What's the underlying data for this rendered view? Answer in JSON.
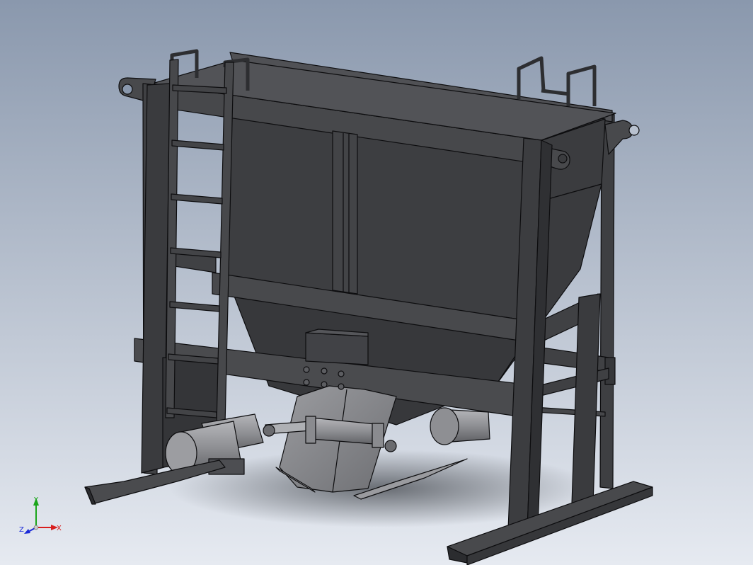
{
  "viewport": {
    "background_top": "#8a98ad",
    "background_bottom": "#e6eaf1",
    "model_dark": "#3a3b3e",
    "model_mid": "#4d4e52",
    "model_light": "#5c5d61",
    "edge_color": "#0d0d0f",
    "grey_part": "#8a8b8f",
    "grey_part_light": "#a4a5a9",
    "shadow": "#6f747d"
  },
  "triad": {
    "x_label": "X",
    "y_label": "Y",
    "z_label": "Z",
    "x_color": "#d81e1e",
    "y_color": "#1aa51a",
    "z_color": "#1a2ad8"
  }
}
